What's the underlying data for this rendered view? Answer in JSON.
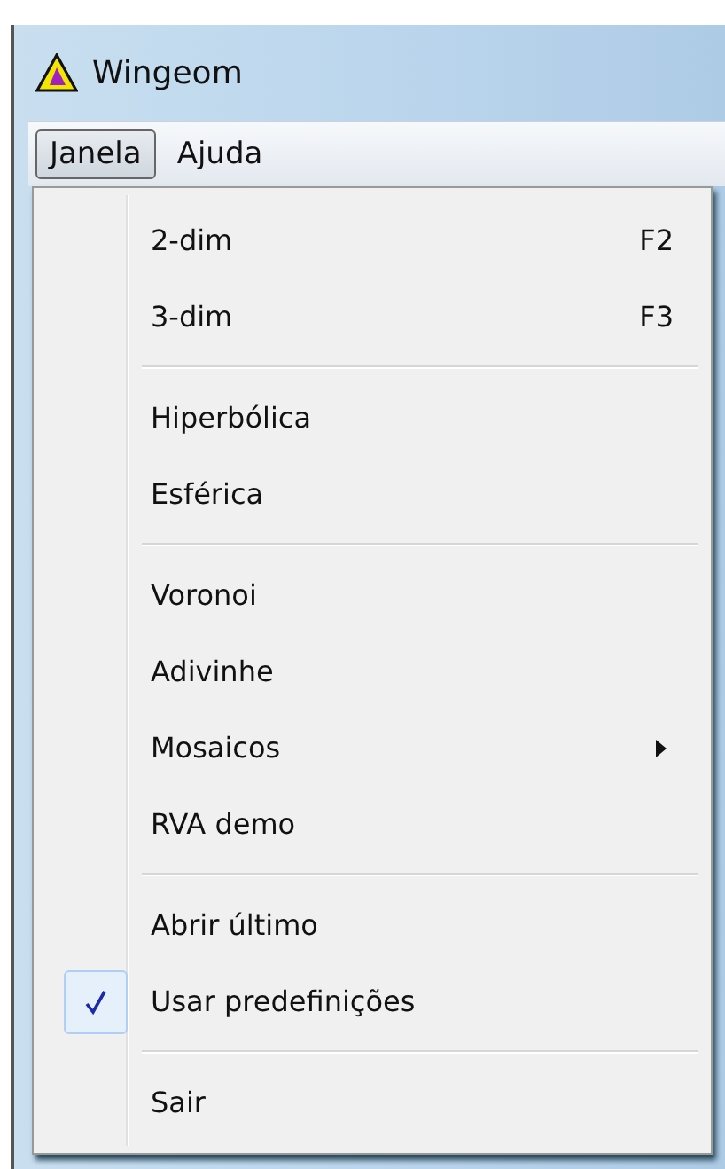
{
  "window": {
    "title": "Wingeom"
  },
  "menu_bar": [
    {
      "label": "Janela",
      "selected": true
    },
    {
      "label": "Ajuda",
      "selected": false
    }
  ],
  "menu": {
    "sections": [
      {
        "items": [
          {
            "label": "2-dim",
            "shortcut": "F2",
            "kind": "command",
            "checked": false
          },
          {
            "label": "3-dim",
            "shortcut": "F3",
            "kind": "command",
            "checked": false
          }
        ]
      },
      {
        "items": [
          {
            "label": "Hiperbólica",
            "kind": "command",
            "checked": false
          },
          {
            "label": "Esférica",
            "kind": "command",
            "checked": false
          }
        ]
      },
      {
        "items": [
          {
            "label": "Voronoi",
            "kind": "command",
            "checked": false
          },
          {
            "label": "Adivinhe",
            "kind": "command",
            "checked": false
          },
          {
            "label": "Mosaicos",
            "kind": "submenu",
            "checked": false
          },
          {
            "label": "RVA demo",
            "kind": "command",
            "checked": false
          }
        ]
      },
      {
        "items": [
          {
            "label": "Abrir último",
            "kind": "command",
            "checked": false
          },
          {
            "label": "Usar predefinições",
            "kind": "command",
            "checked": true
          }
        ]
      },
      {
        "items": [
          {
            "label": "Sair",
            "kind": "command",
            "checked": false
          }
        ]
      }
    ]
  }
}
